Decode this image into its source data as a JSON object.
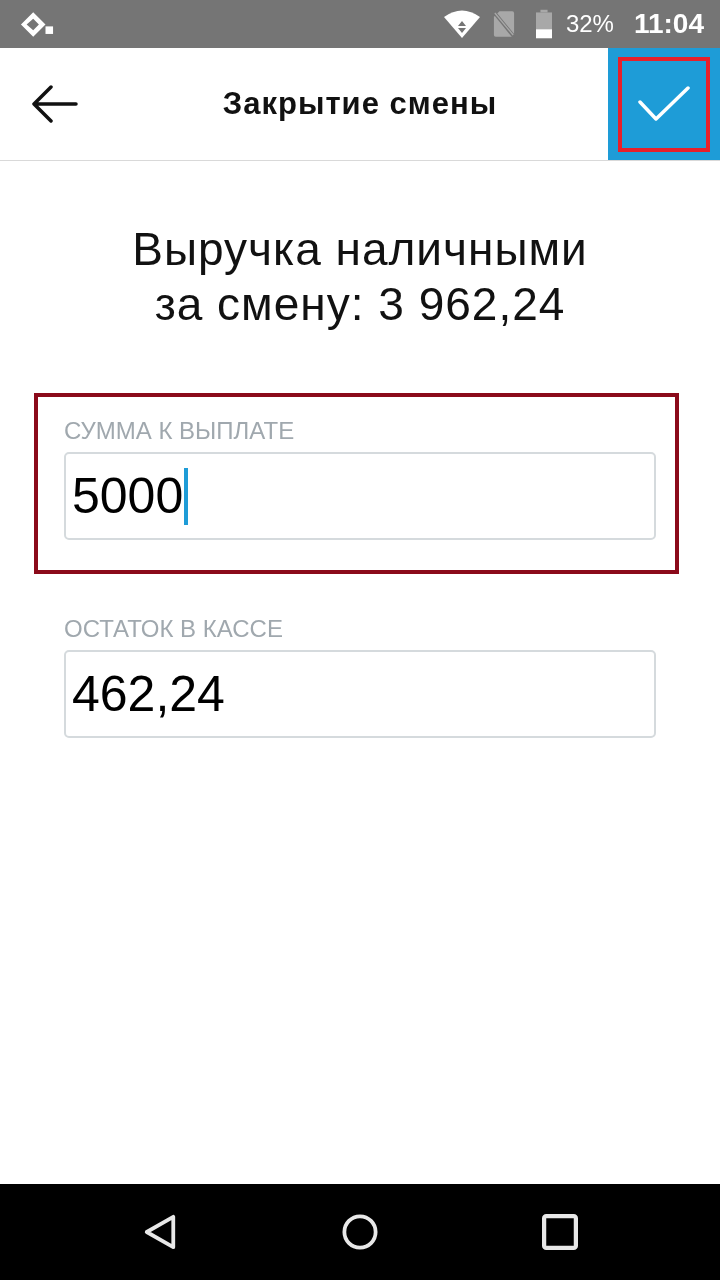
{
  "status_bar": {
    "battery": "32%",
    "time": "11:04"
  },
  "app_bar": {
    "title": "Закрытие смены",
    "confirm": {
      "highlighted": true
    }
  },
  "summary": {
    "text": "Выручка наличными за смену: 3 962,24"
  },
  "fields": [
    {
      "label": "СУММА К ВЫПЛАТЕ",
      "value": "5000",
      "focused": true,
      "highlighted": true
    },
    {
      "label": "ОСТАТОК В КАССЕ",
      "value": "462,24",
      "focused": false,
      "highlighted": false
    }
  ]
}
